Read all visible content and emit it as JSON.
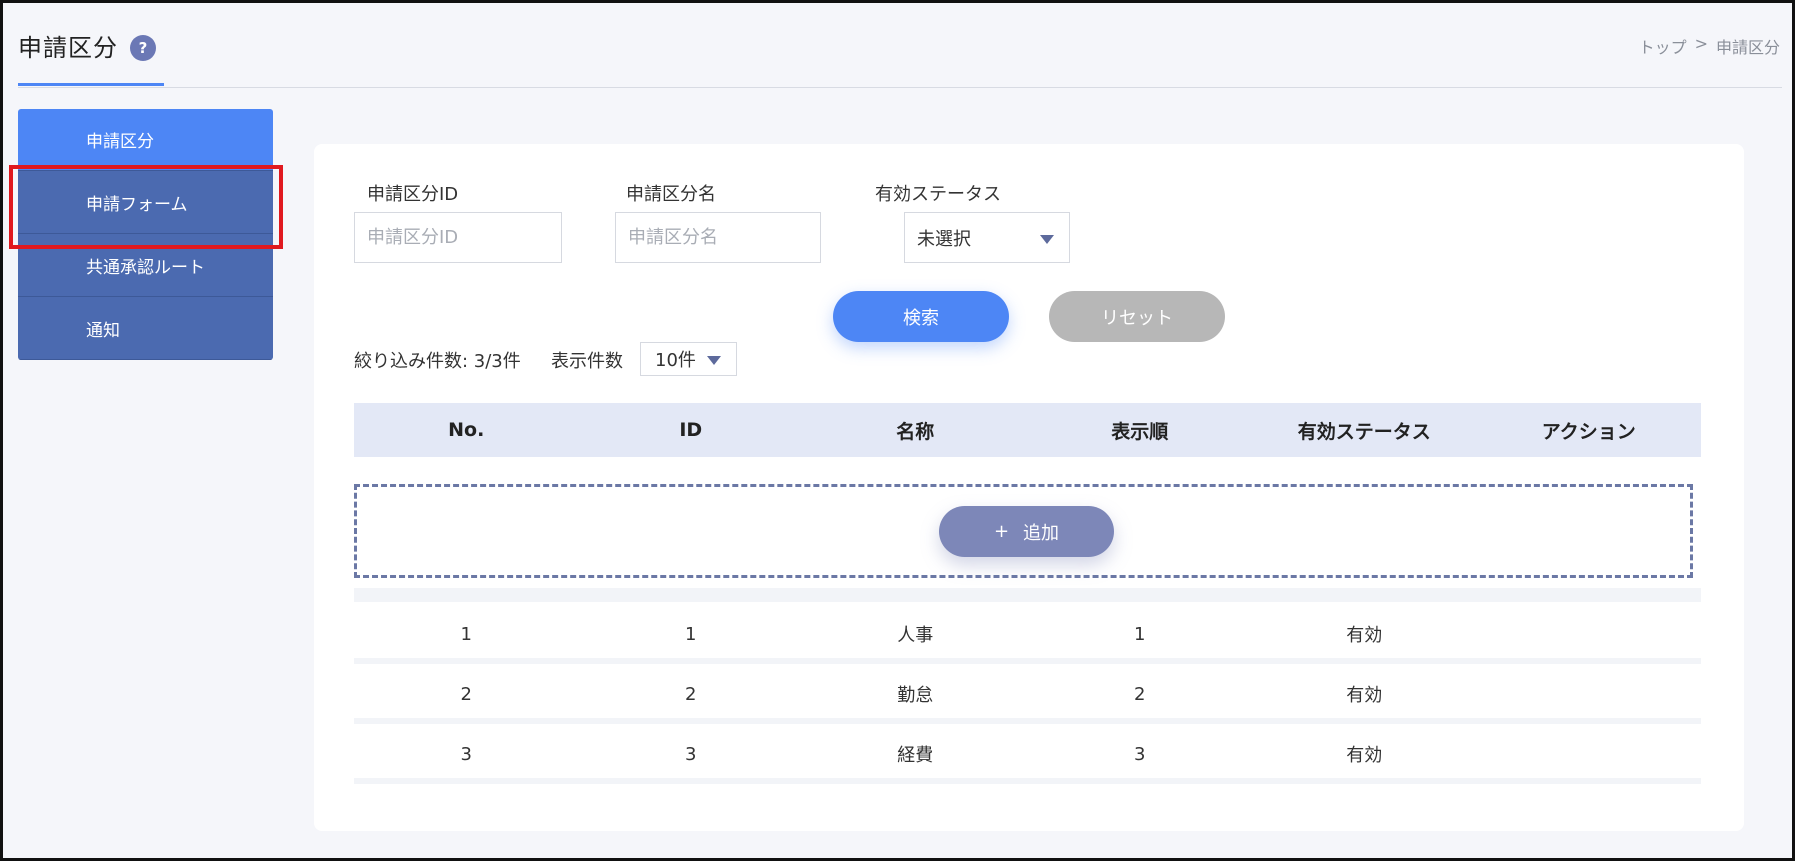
{
  "header": {
    "title": "申請区分",
    "help_icon": "?",
    "breadcrumb": [
      "トップ",
      ">",
      "申請区分"
    ]
  },
  "sidebar": {
    "items": [
      {
        "label": "申請区分",
        "active": true
      },
      {
        "label": "申請フォーム",
        "active": false
      },
      {
        "label": "共通承認ルート",
        "active": false
      },
      {
        "label": "通知",
        "active": false
      }
    ]
  },
  "search": {
    "id_label": "申請区分ID",
    "id_placeholder": "申請区分ID",
    "name_label": "申請区分名",
    "name_placeholder": "申請区分名",
    "status_label": "有効ステータス",
    "status_value": "未選択",
    "search_button": "検索",
    "reset_button": "リセット"
  },
  "list": {
    "count_text": "絞り込み件数: 3/3件",
    "per_page_label": "表示件数",
    "per_page_value": "10件"
  },
  "table": {
    "headers": [
      "No.",
      "ID",
      "名称",
      "表示順",
      "有効ステータス",
      "アクション"
    ],
    "add_button_icon": "+",
    "add_button_label": "追加",
    "rows": [
      [
        "1",
        "1",
        "人事",
        "1",
        "有効",
        ""
      ],
      [
        "2",
        "2",
        "勤怠",
        "2",
        "有効",
        ""
      ],
      [
        "3",
        "3",
        "経費",
        "3",
        "有効",
        ""
      ]
    ]
  },
  "colors": {
    "accent": "#4d86f5",
    "sidebar": "#4b6ab0",
    "highlight": "#e0191f"
  }
}
